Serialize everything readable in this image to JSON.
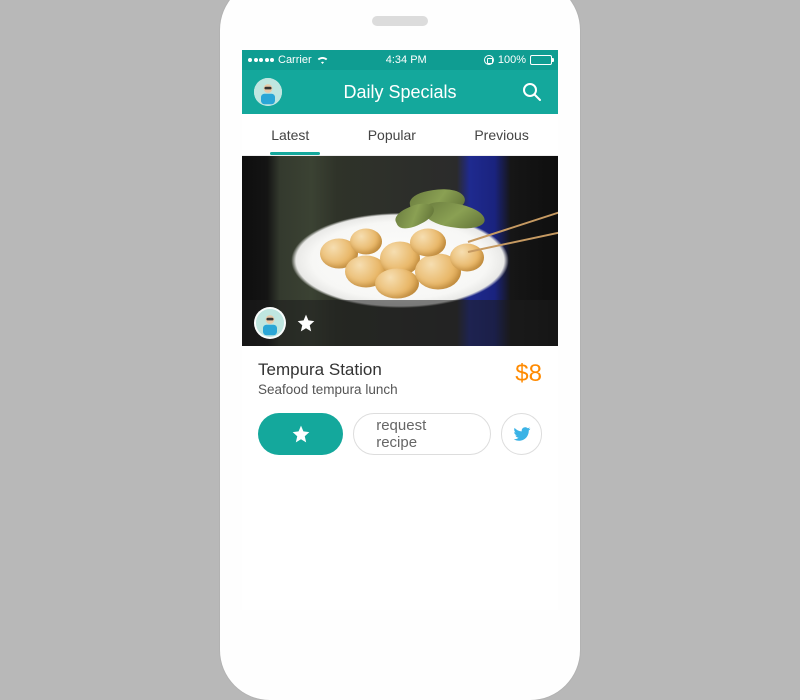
{
  "statusbar": {
    "carrier": "Carrier",
    "time": "4:34 PM",
    "battery_pct": "100%"
  },
  "header": {
    "title": "Daily Specials"
  },
  "tabs": [
    {
      "label": "Latest",
      "active": true
    },
    {
      "label": "Popular",
      "active": false
    },
    {
      "label": "Previous",
      "active": false
    }
  ],
  "dish": {
    "title": "Tempura Station",
    "subtitle": "Seafood tempura lunch",
    "price": "$8"
  },
  "actions": {
    "request_label": "request recipe"
  },
  "colors": {
    "accent": "#14a89c",
    "price": "#ff8a00"
  }
}
